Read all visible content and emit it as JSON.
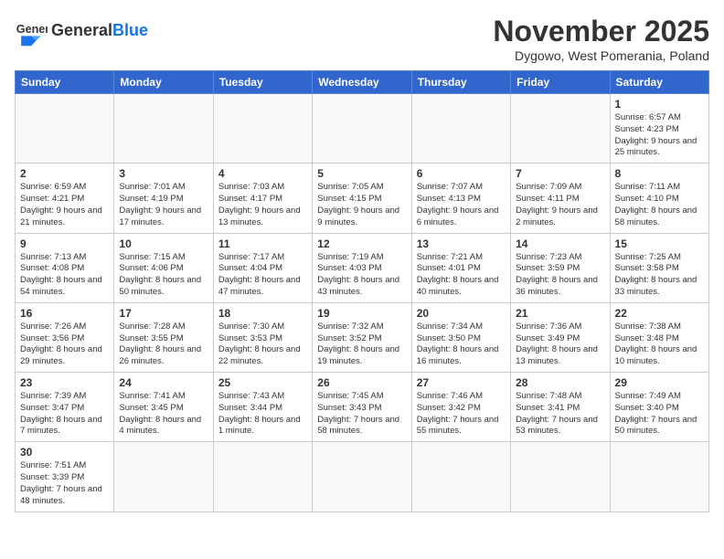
{
  "header": {
    "logo_general": "General",
    "logo_blue": "Blue",
    "month_title": "November 2025",
    "location": "Dygowo, West Pomerania, Poland"
  },
  "weekdays": [
    "Sunday",
    "Monday",
    "Tuesday",
    "Wednesday",
    "Thursday",
    "Friday",
    "Saturday"
  ],
  "weeks": [
    [
      {
        "day": "",
        "info": ""
      },
      {
        "day": "",
        "info": ""
      },
      {
        "day": "",
        "info": ""
      },
      {
        "day": "",
        "info": ""
      },
      {
        "day": "",
        "info": ""
      },
      {
        "day": "",
        "info": ""
      },
      {
        "day": "1",
        "info": "Sunrise: 6:57 AM\nSunset: 4:23 PM\nDaylight: 9 hours\nand 25 minutes."
      }
    ],
    [
      {
        "day": "2",
        "info": "Sunrise: 6:59 AM\nSunset: 4:21 PM\nDaylight: 9 hours\nand 21 minutes."
      },
      {
        "day": "3",
        "info": "Sunrise: 7:01 AM\nSunset: 4:19 PM\nDaylight: 9 hours\nand 17 minutes."
      },
      {
        "day": "4",
        "info": "Sunrise: 7:03 AM\nSunset: 4:17 PM\nDaylight: 9 hours\nand 13 minutes."
      },
      {
        "day": "5",
        "info": "Sunrise: 7:05 AM\nSunset: 4:15 PM\nDaylight: 9 hours\nand 9 minutes."
      },
      {
        "day": "6",
        "info": "Sunrise: 7:07 AM\nSunset: 4:13 PM\nDaylight: 9 hours\nand 6 minutes."
      },
      {
        "day": "7",
        "info": "Sunrise: 7:09 AM\nSunset: 4:11 PM\nDaylight: 9 hours\nand 2 minutes."
      },
      {
        "day": "8",
        "info": "Sunrise: 7:11 AM\nSunset: 4:10 PM\nDaylight: 8 hours\nand 58 minutes."
      }
    ],
    [
      {
        "day": "9",
        "info": "Sunrise: 7:13 AM\nSunset: 4:08 PM\nDaylight: 8 hours\nand 54 minutes."
      },
      {
        "day": "10",
        "info": "Sunrise: 7:15 AM\nSunset: 4:06 PM\nDaylight: 8 hours\nand 50 minutes."
      },
      {
        "day": "11",
        "info": "Sunrise: 7:17 AM\nSunset: 4:04 PM\nDaylight: 8 hours\nand 47 minutes."
      },
      {
        "day": "12",
        "info": "Sunrise: 7:19 AM\nSunset: 4:03 PM\nDaylight: 8 hours\nand 43 minutes."
      },
      {
        "day": "13",
        "info": "Sunrise: 7:21 AM\nSunset: 4:01 PM\nDaylight: 8 hours\nand 40 minutes."
      },
      {
        "day": "14",
        "info": "Sunrise: 7:23 AM\nSunset: 3:59 PM\nDaylight: 8 hours\nand 36 minutes."
      },
      {
        "day": "15",
        "info": "Sunrise: 7:25 AM\nSunset: 3:58 PM\nDaylight: 8 hours\nand 33 minutes."
      }
    ],
    [
      {
        "day": "16",
        "info": "Sunrise: 7:26 AM\nSunset: 3:56 PM\nDaylight: 8 hours\nand 29 minutes."
      },
      {
        "day": "17",
        "info": "Sunrise: 7:28 AM\nSunset: 3:55 PM\nDaylight: 8 hours\nand 26 minutes."
      },
      {
        "day": "18",
        "info": "Sunrise: 7:30 AM\nSunset: 3:53 PM\nDaylight: 8 hours\nand 22 minutes."
      },
      {
        "day": "19",
        "info": "Sunrise: 7:32 AM\nSunset: 3:52 PM\nDaylight: 8 hours\nand 19 minutes."
      },
      {
        "day": "20",
        "info": "Sunrise: 7:34 AM\nSunset: 3:50 PM\nDaylight: 8 hours\nand 16 minutes."
      },
      {
        "day": "21",
        "info": "Sunrise: 7:36 AM\nSunset: 3:49 PM\nDaylight: 8 hours\nand 13 minutes."
      },
      {
        "day": "22",
        "info": "Sunrise: 7:38 AM\nSunset: 3:48 PM\nDaylight: 8 hours\nand 10 minutes."
      }
    ],
    [
      {
        "day": "23",
        "info": "Sunrise: 7:39 AM\nSunset: 3:47 PM\nDaylight: 8 hours\nand 7 minutes."
      },
      {
        "day": "24",
        "info": "Sunrise: 7:41 AM\nSunset: 3:45 PM\nDaylight: 8 hours\nand 4 minutes."
      },
      {
        "day": "25",
        "info": "Sunrise: 7:43 AM\nSunset: 3:44 PM\nDaylight: 8 hours\nand 1 minute."
      },
      {
        "day": "26",
        "info": "Sunrise: 7:45 AM\nSunset: 3:43 PM\nDaylight: 7 hours\nand 58 minutes."
      },
      {
        "day": "27",
        "info": "Sunrise: 7:46 AM\nSunset: 3:42 PM\nDaylight: 7 hours\nand 55 minutes."
      },
      {
        "day": "28",
        "info": "Sunrise: 7:48 AM\nSunset: 3:41 PM\nDaylight: 7 hours\nand 53 minutes."
      },
      {
        "day": "29",
        "info": "Sunrise: 7:49 AM\nSunset: 3:40 PM\nDaylight: 7 hours\nand 50 minutes."
      }
    ],
    [
      {
        "day": "30",
        "info": "Sunrise: 7:51 AM\nSunset: 3:39 PM\nDaylight: 7 hours\nand 48 minutes."
      },
      {
        "day": "",
        "info": ""
      },
      {
        "day": "",
        "info": ""
      },
      {
        "day": "",
        "info": ""
      },
      {
        "day": "",
        "info": ""
      },
      {
        "day": "",
        "info": ""
      },
      {
        "day": "",
        "info": ""
      }
    ]
  ]
}
